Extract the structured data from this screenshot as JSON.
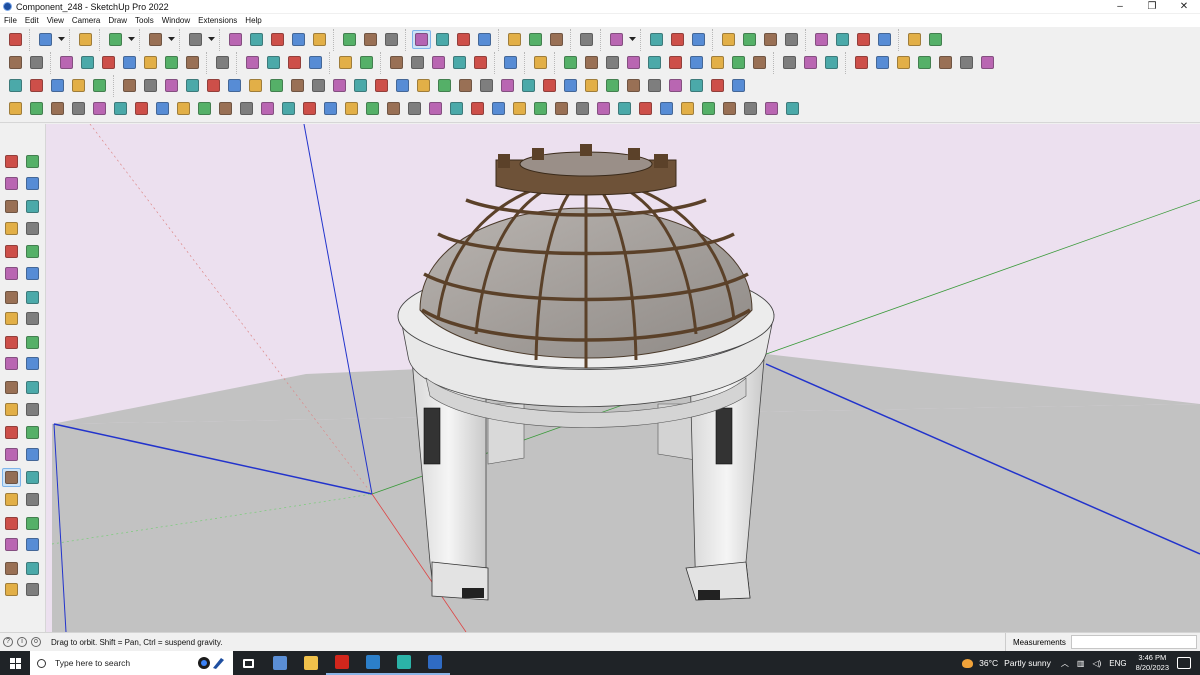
{
  "window": {
    "title": "Component_248 - SketchUp Pro 2022",
    "controls": [
      "–",
      "❐",
      "✕"
    ]
  },
  "menu": [
    "File",
    "Edit",
    "View",
    "Camera",
    "Draw",
    "Tools",
    "Window",
    "Extensions",
    "Help"
  ],
  "toolbars": {
    "rows": [
      [
        {
          "icons": [
            "search-icon"
          ]
        },
        {
          "icons": [
            "select-arrow-icon",
            "dropdown-icon"
          ]
        },
        {
          "icons": [
            "eraser-icon"
          ]
        },
        {
          "icons": [
            "pencil-line-icon",
            "dropdown-icon"
          ]
        },
        {
          "icons": [
            "arc-icon",
            "dropdown-icon"
          ]
        },
        {
          "icons": [
            "rectangle-icon",
            "dropdown-icon"
          ]
        },
        {
          "icons": [
            "push-pull-icon",
            "follow-me-icon",
            "move-icon",
            "rotate-icon",
            "scale-icon"
          ]
        },
        {
          "icons": [
            "tape-measure-icon",
            "text-icon",
            "paint-bucket-icon"
          ]
        },
        {
          "icons": [
            "orbit-icon",
            "pan-icon",
            "zoom-icon",
            "zoom-extents-icon"
          ]
        },
        {
          "icons": [
            "3d-warehouse-icon",
            "extension-warehouse-icon",
            "layout-icon"
          ]
        },
        {
          "icons": [
            "extension-manager-icon"
          ]
        },
        {
          "icons": [
            "user-account-icon",
            "dropdown-icon"
          ]
        },
        {
          "icons": [
            "section-plane-icon",
            "section-cut-icon",
            "section-fill-icon"
          ]
        },
        {
          "icons": [
            "solid-outer-shell-icon",
            "solid-intersect-icon",
            "solid-union-icon",
            "solid-subtract-icon"
          ]
        },
        {
          "icons": [
            "sandbox-from-contours-icon",
            "sandbox-from-scratch-icon",
            "sandbox-smoove-icon",
            "sandbox-stamp-icon"
          ]
        },
        {
          "icons": [
            "undo-style-icon",
            "redo-style-icon"
          ]
        }
      ],
      [
        {
          "icons": [
            "component-icon",
            "group-icon"
          ]
        },
        {
          "icons": [
            "view-iso-icon",
            "view-top-icon",
            "view-front-icon",
            "view-right-icon",
            "view-back-icon",
            "view-left-icon",
            "view-bottom-icon"
          ]
        },
        {
          "icons": [
            "curve-icon"
          ]
        },
        {
          "icons": [
            "xray-icon",
            "back-edges-icon",
            "wireframe-icon",
            "hidden-line-icon"
          ]
        },
        {
          "icons": [
            "shaded-icon",
            "shaded-textures-icon"
          ]
        },
        {
          "icons": [
            "warehouse-box-icon",
            "house-icon",
            "gear-house-icon",
            "house-2-icon",
            "house-3-icon"
          ]
        },
        {
          "icons": [
            "fredo-scale-icon"
          ]
        },
        {
          "icons": [
            "leaf-icon"
          ]
        },
        {
          "icons": [
            "paint-brush-icon",
            "shape-1-icon",
            "shape-2-icon",
            "shape-3-icon",
            "shape-4-icon",
            "shape-5-icon",
            "shape-6-icon",
            "shape-7-icon",
            "shape-8-icon",
            "shape-9-icon"
          ]
        },
        {
          "icons": [
            "lasso-icon",
            "tag-icon",
            "hand-icon"
          ]
        },
        {
          "icons": [
            "box-1-icon",
            "box-2-icon",
            "box-3-icon",
            "box-4-icon",
            "box-5-icon",
            "box-6-icon",
            "box-7-icon"
          ]
        }
      ],
      [
        {
          "icons": [
            "ruby-cube-icon",
            "ruby-cube-2-icon",
            "ruby-layer-icon",
            "ruby-icon",
            "hex-tool-icon"
          ]
        },
        {
          "icons": [
            "tool-a-icon",
            "tool-b-icon",
            "tool-c-icon",
            "tool-d-icon",
            "tool-e-icon",
            "tool-f-icon",
            "tool-g-icon",
            "tool-h-icon",
            "tool-i-icon",
            "tool-j-icon",
            "tool-k-icon",
            "tool-l-icon",
            "tool-m-icon",
            "tool-n-icon",
            "tool-o-icon",
            "tool-p-icon",
            "tool-q-icon",
            "tool-r-icon",
            "tool-s-icon",
            "tool-t-icon",
            "tool-u-icon",
            "tool-v-icon",
            "tool-w-icon",
            "tool-x-icon",
            "tool-y-icon",
            "tool-z-icon",
            "tool-aa-icon",
            "tool-ab-icon",
            "tool-ac-icon",
            "tool-ad-icon"
          ]
        }
      ],
      [
        {
          "icons": [
            "curve-1-icon",
            "curve-2-icon",
            "curve-3-icon",
            "curve-4-icon",
            "curve-5-icon",
            "curve-6-icon",
            "curve-7-icon",
            "curve-8-icon",
            "curve-9-icon",
            "curve-10-icon",
            "curve-11-icon",
            "curve-12-icon",
            "curve-13-icon",
            "curve-14-icon",
            "curve-15-icon",
            "curve-16-icon",
            "curve-17-icon",
            "curve-18-icon",
            "curve-19-icon",
            "curve-20-icon",
            "curve-21-icon",
            "curve-22-icon",
            "curve-23-icon",
            "curve-24-icon",
            "curve-25-icon",
            "curve-26-icon",
            "curve-27-icon",
            "curve-28-icon",
            "curve-29-icon",
            "curve-30-icon",
            "curve-31-icon",
            "curve-32-icon",
            "curve-33-icon",
            "curve-34-icon",
            "curve-35-icon",
            "curve-36-icon",
            "curve-37-icon",
            "curve-38-icon"
          ]
        }
      ]
    ],
    "active_tool": "orbit-icon",
    "palette": [
      "#c8342c",
      "#3d7bd1",
      "#e0a42a",
      "#3aa651",
      "#8a5a3b",
      "#6b6b6b",
      "#b04fa8",
      "#2f9d9d"
    ]
  },
  "left_tools": [
    "select-icon",
    "component-icon",
    "paint-bucket-icon",
    "eraser-icon",
    "tag-icon",
    "pencil-icon",
    "line-icon",
    "freehand-icon",
    "rectangle-icon",
    "rotated-rectangle-icon",
    "circle-icon",
    "polygon-icon",
    "arc-icon",
    "pie-icon",
    "3pt-arc-icon",
    "2pt-arc-icon",
    "move-icon",
    "push-pull-icon",
    "rotate-icon",
    "follow-me-icon",
    "scale-icon",
    "offset-icon",
    "tape-measure-icon",
    "dimension-icon",
    "protractor-icon",
    "text-icon",
    "axes-icon",
    "3d-text-icon",
    "orbit-icon",
    "pan-icon",
    "zoom-icon",
    "zoom-window-icon",
    "zoom-extents-icon",
    "previous-view-icon",
    "position-camera-icon",
    "look-around-icon",
    "walk-icon",
    "section-plane-icon",
    "3d-warehouse-icon",
    "extension-warehouse-icon"
  ],
  "viewport": {
    "sky_color": "#ece0ef",
    "ground_color": "#c2c2c2",
    "axis_red": "#d44",
    "axis_green": "#3a9a3a",
    "axis_blue": "#2233cc"
  },
  "status": {
    "hint": "Drag to orbit. Shift = Pan, Ctrl = suspend gravity.",
    "measurements_label": "Measurements",
    "measurements_value": ""
  },
  "taskbar": {
    "search_placeholder": "Type here to search",
    "apps": [
      "task-view-icon",
      "calculator-icon",
      "file-explorer-icon",
      "acrobat-icon",
      "photoshop-icon",
      "edge-icon",
      "sketchup-icon"
    ],
    "app_colors": [
      "#ffffff",
      "#5b8fd6",
      "#f0c14b",
      "#d2261c",
      "#2c7fc9",
      "#2bb3a8",
      "#2f6bc4"
    ],
    "weather_temp": "36°C",
    "weather_text": "Partly sunny",
    "language": "ENG",
    "time": "3:46 PM",
    "date": "8/20/2023"
  }
}
